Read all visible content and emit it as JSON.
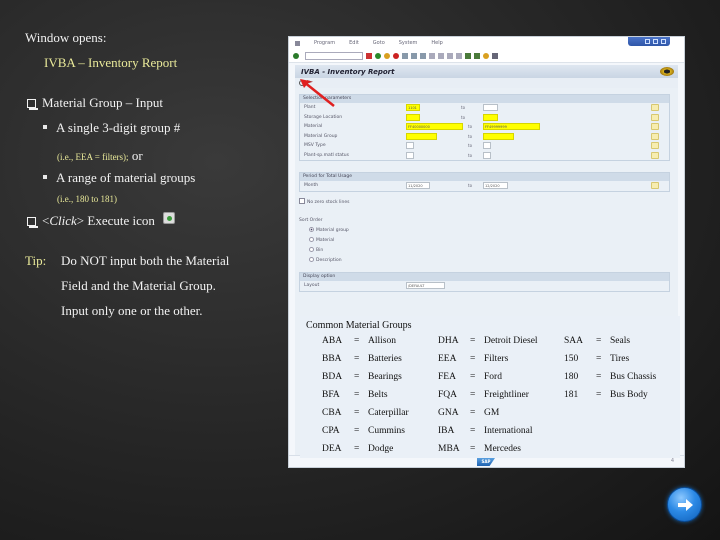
{
  "slide": {
    "intro": "Window opens:",
    "report_title": "IVBA – Inventory Report",
    "bullet1": "Material Group – Input",
    "sub1": "A single 3-digit group #",
    "sub1_note": "(i.e., EEA = filters);",
    "sub1_or": " or",
    "sub2": "A range of material groups",
    "sub2_note": "(i.e., 180 to 181)",
    "bullet2_click": "Click",
    "bullet2_rest": " Execute icon",
    "tip_label": "Tip:",
    "tip_lines": [
      "Do NOT input both the Material",
      "Field and the Material Group.",
      "Input only one or the other."
    ]
  },
  "sap": {
    "menu": [
      "Program",
      "Edit",
      "Goto",
      "System",
      "Help"
    ],
    "window_title": "IVBA - Inventory Report",
    "selection": {
      "heading": "Selection parameters",
      "rows": [
        {
          "label": "Plant",
          "from": "1101",
          "to": ""
        },
        {
          "label": "Storage Location",
          "from": "",
          "to": ""
        },
        {
          "label": "Material",
          "from": "FF40000000",
          "to": "FF49999999"
        },
        {
          "label": "Material Group",
          "from": "",
          "to": ""
        },
        {
          "label": "MSV Type",
          "from": "",
          "to": ""
        },
        {
          "label": "Plant-sp.matl status",
          "from": "",
          "to": ""
        }
      ],
      "to_label": "to"
    },
    "period": {
      "heading": "Period for Total Usage",
      "label": "Month",
      "from": "11/2020",
      "to_label": "to",
      "to": "12/2020"
    },
    "no_zero_label": "No zero stock lines",
    "sort_order": {
      "heading": "Sort Order",
      "options": [
        "Material group",
        "Material",
        "Bin",
        "Description"
      ],
      "selected": "Material group"
    },
    "display": {
      "heading": "Display option",
      "label": "Layout",
      "value": "/DEFAULT"
    },
    "status_logo": "SAP",
    "status_num": "4"
  },
  "common_groups": {
    "title": "Common Material Groups",
    "columns": [
      [
        {
          "code": "ABA",
          "name": "Allison"
        },
        {
          "code": "BBA",
          "name": "Batteries"
        },
        {
          "code": "BDA",
          "name": "Bearings"
        },
        {
          "code": "BFA",
          "name": "Belts"
        },
        {
          "code": "CBA",
          "name": "Caterpillar"
        },
        {
          "code": "CPA",
          "name": "Cummins"
        },
        {
          "code": "DEA",
          "name": "Dodge"
        }
      ],
      [
        {
          "code": "DHA",
          "name": "Detroit Diesel"
        },
        {
          "code": "EEA",
          "name": "Filters"
        },
        {
          "code": "FEA",
          "name": "Ford"
        },
        {
          "code": "FQA",
          "name": "Freightliner"
        },
        {
          "code": "GNA",
          "name": "GM"
        },
        {
          "code": "IBA",
          "name": "International"
        },
        {
          "code": "MBA",
          "name": "Mercedes"
        }
      ],
      [
        {
          "code": "SAA",
          "name": "Seals"
        },
        {
          "code": "150",
          "name": "Tires"
        },
        {
          "code": "180",
          "name": "Bus Chassis"
        },
        {
          "code": "181",
          "name": "Bus Body"
        }
      ]
    ],
    "eq": "="
  }
}
